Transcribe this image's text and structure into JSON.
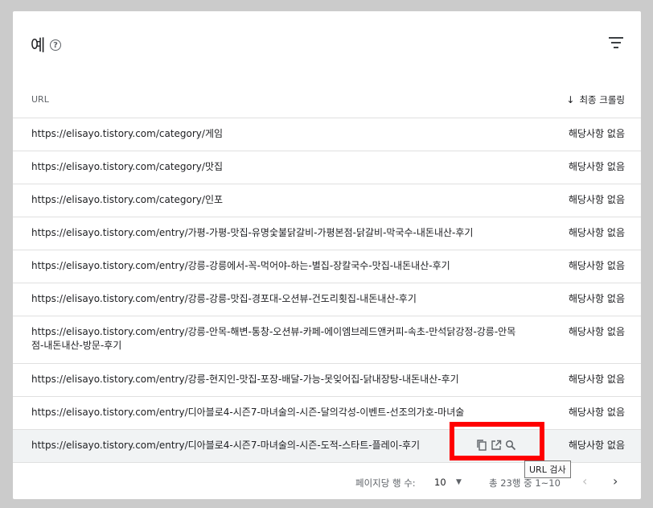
{
  "card": {
    "title": "예",
    "help_icon": "help-circle-icon",
    "filter_icon": "filter-icon"
  },
  "table": {
    "headers": {
      "url": "URL",
      "crawl": "최종 크롤링"
    },
    "rows": [
      {
        "url": "https://elisayo.tistory.com/category/게임",
        "crawl": "해당사항 없음"
      },
      {
        "url": "https://elisayo.tistory.com/category/맛집",
        "crawl": "해당사항 없음"
      },
      {
        "url": "https://elisayo.tistory.com/category/인포",
        "crawl": "해당사항 없음"
      },
      {
        "url": "https://elisayo.tistory.com/entry/가평-가평-맛집-유명숯불닭갈비-가평본점-닭갈비-막국수-내돈내산-후기",
        "crawl": "해당사항 없음"
      },
      {
        "url": "https://elisayo.tistory.com/entry/강릉-강릉에서-꼭-먹어야-하는-별집-장칼국수-맛집-내돈내산-후기",
        "crawl": "해당사항 없음"
      },
      {
        "url": "https://elisayo.tistory.com/entry/강릉-강릉-맛집-경포대-오션뷰-건도리횟집-내돈내산-후기",
        "crawl": "해당사항 없음"
      },
      {
        "url": "https://elisayo.tistory.com/entry/강릉-안목-해변-통창-오션뷰-카페-에이엠브레드앤커피-속초-만석닭강정-강릉-안목점-내돈내산-방문-후기",
        "crawl": "해당사항 없음"
      },
      {
        "url": "https://elisayo.tistory.com/entry/강릉-현지인-맛집-포장-배달-가능-못잊어집-닭내장탕-내돈내산-후기",
        "crawl": "해당사항 없음"
      },
      {
        "url": "https://elisayo.tistory.com/entry/디아블로4-시즌7-마녀술의-시즌-달의각성-이벤트-선조의가호-마녀술",
        "crawl": "해당사항 없음"
      },
      {
        "url": "https://elisayo.tistory.com/entry/디아블로4-시즌7-마녀술의-시즌-도적-스타트-플레이-후기",
        "crawl": "해당사항 없음"
      }
    ],
    "row_actions": [
      "copy-icon",
      "open-in-new-icon",
      "search-icon"
    ]
  },
  "tooltip": {
    "text": "URL 검사"
  },
  "footer": {
    "rows_per_page_label": "페이지당 행 수:",
    "rows_per_page_value": "10",
    "range": "총 23행 중 1~10",
    "prev": "‹",
    "next": "›"
  },
  "colors": {
    "highlight": "#ff0000",
    "hover_row": "#f1f3f4"
  }
}
